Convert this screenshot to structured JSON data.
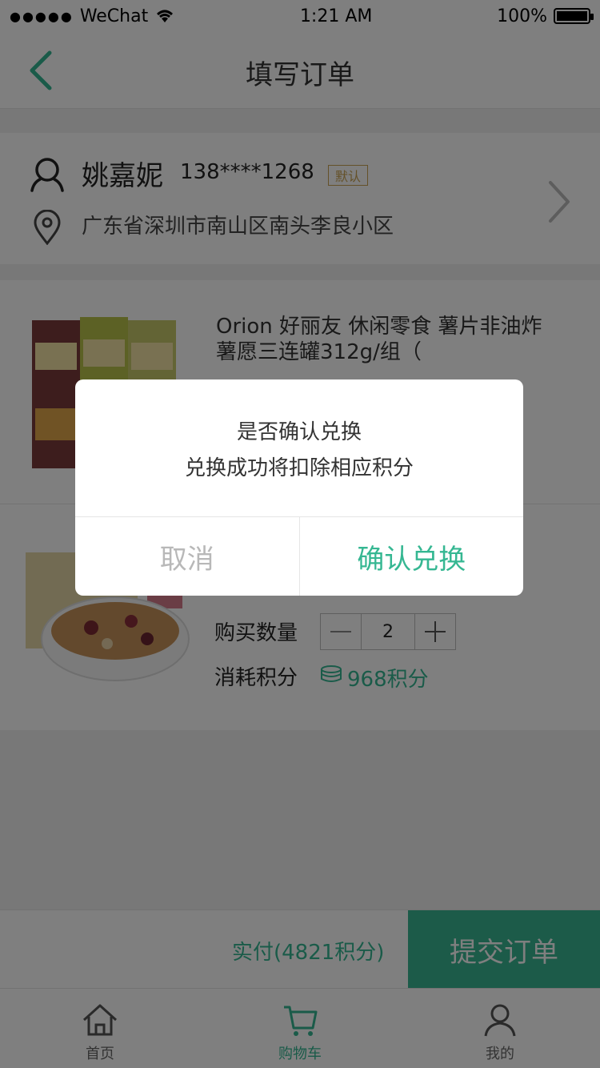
{
  "status_bar": {
    "carrier": "WeChat",
    "time": "1:21 AM",
    "battery": "100%"
  },
  "nav": {
    "title": "填写订单"
  },
  "address": {
    "name": "姚嘉妮",
    "phone": "138****1268",
    "default_badge": "默认",
    "line": "广东省深圳市南山区南头李良小区"
  },
  "items": [
    {
      "title": "Orion 好丽友 休闲零食 薯片非油炸 薯愿三连罐312g/组（"
    },
    {
      "qty_label": "购买数量",
      "qty_value": "2",
      "cost_label": "消耗积分",
      "cost_value": "968积分"
    }
  ],
  "pay_bar": {
    "text": "实付(4821积分)",
    "submit_label": "提交订单"
  },
  "tabs": [
    {
      "label": "首页"
    },
    {
      "label": "购物车"
    },
    {
      "label": "我的"
    }
  ],
  "modal": {
    "line1": "是否确认兑换",
    "line2": "兑换成功将扣除相应积分",
    "cancel_label": "取消",
    "confirm_label": "确认兑换"
  },
  "colors": {
    "accent": "#35b792",
    "badge": "#c9a253"
  }
}
